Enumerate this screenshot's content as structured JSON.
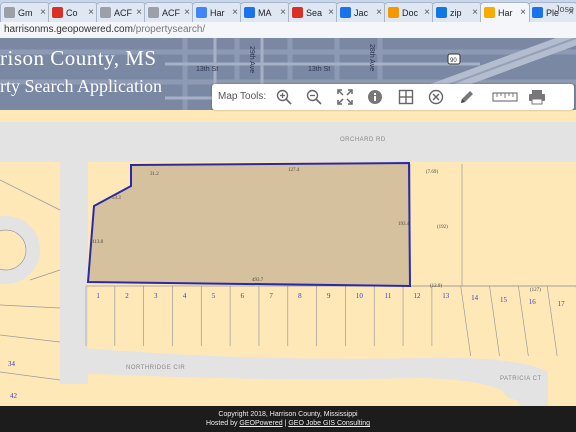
{
  "browser": {
    "tabs": [
      {
        "label": "Gm",
        "icon": "document-icon",
        "color": "#9aa0a6",
        "active": false
      },
      {
        "label": "Co",
        "icon": "gmail-icon",
        "color": "#d93025",
        "active": false
      },
      {
        "label": "ACF",
        "icon": "document-icon",
        "color": "#9aa0a6",
        "active": false
      },
      {
        "label": "ACF",
        "icon": "document-icon",
        "color": "#9aa0a6",
        "active": false
      },
      {
        "label": "Har",
        "icon": "google-icon",
        "color": "#4285f4",
        "active": false
      },
      {
        "label": "MA",
        "icon": "map-pin-icon",
        "color": "#1a73e8",
        "active": false
      },
      {
        "label": "Sea",
        "icon": "realtor-icon",
        "color": "#d93025",
        "active": false
      },
      {
        "label": "Jac",
        "icon": "map-pin-icon",
        "color": "#1a73e8",
        "active": false
      },
      {
        "label": "Doc",
        "icon": "download-icon",
        "color": "#f29900",
        "active": false
      },
      {
        "label": "zip",
        "icon": "zillow-icon",
        "color": "#1277e1",
        "active": false
      },
      {
        "label": "Har",
        "icon": "location-icon",
        "color": "#f9ab00",
        "active": true
      },
      {
        "label": "Ple",
        "icon": "flag-icon",
        "color": "#1a73e8",
        "active": false
      }
    ],
    "profile": "Jose",
    "url": "harrisonms.geopowered.com",
    "url_path": "/propertysearch/"
  },
  "header": {
    "title_line1": "rison County, MS",
    "title_line2": "rty Search Application",
    "streets": [
      "13th St",
      "13th St",
      "29th Ave",
      "28th Ave"
    ]
  },
  "map_tools": {
    "label": "Map Tools:",
    "tools": [
      "zoom-in",
      "zoom-out",
      "full-extent",
      "identify",
      "select",
      "clear",
      "draw",
      "measure",
      "print"
    ]
  },
  "map": {
    "roads": [
      "NORTHRIDGE CIR",
      "ORCHARD RD",
      "PATRICIA CT"
    ],
    "lots_top": [
      "1",
      "2",
      "3",
      "4",
      "5",
      "6",
      "7",
      "8",
      "9",
      "10",
      "11",
      "12",
      "13",
      "14",
      "15",
      "16",
      "17"
    ],
    "lots_bottom": [
      "34",
      "42"
    ],
    "dims": [
      "127.4",
      "53.3",
      "193.4",
      "113.8",
      "493.7",
      "195.5",
      "31.2",
      "(7.69)",
      "(192)",
      "(12.9)",
      "(127)",
      "195.7"
    ],
    "colors": {
      "parcel_fill": "#ffe6b4",
      "selected_fill": "#d6c19e",
      "selected_outline": "#2a2aa8",
      "road": "#e3e3e3"
    }
  },
  "footer": {
    "copyright": "Copyright 2018, Harrison County, Mississippi",
    "hosted_prefix": "Hosted by ",
    "hosted_by": "GEOPowered",
    "sep": " | ",
    "consulting": "GEO Jobe GIS Consulting"
  }
}
